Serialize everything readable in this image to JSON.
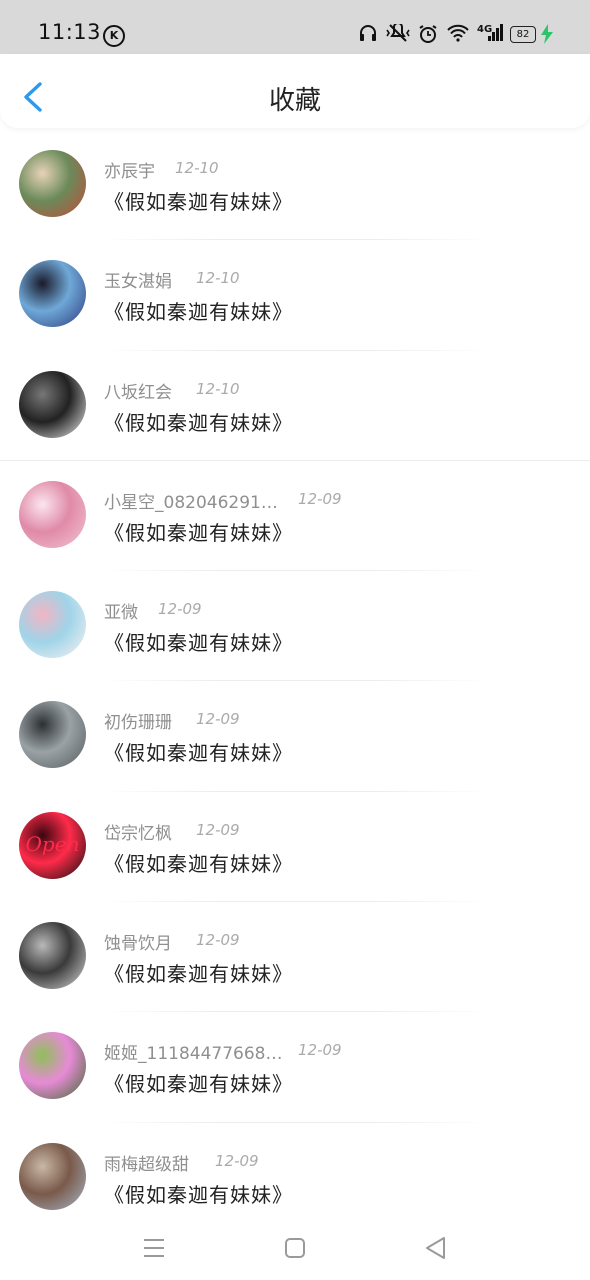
{
  "status_bar": {
    "time": "11:13",
    "k_badge": "K",
    "network": "4G",
    "battery": "82",
    "icons": [
      "headphones-icon",
      "mute-icon",
      "alarm-icon",
      "wifi-icon",
      "signal-icon",
      "battery-icon",
      "charging-icon"
    ]
  },
  "header": {
    "title": "收藏",
    "back_icon": "chevron-left-icon",
    "accent_color": "#2a9af0"
  },
  "items": [
    {
      "username": "亦辰宇",
      "date": "12-10",
      "title": "《假如秦迦有妹妹》",
      "avatar_colors": [
        "#c44a3a",
        "#6b8a5a",
        "#e8d3b8"
      ]
    },
    {
      "username": "玉女湛娟",
      "date": "12-10",
      "title": "《假如秦迦有妹妹》",
      "avatar_colors": [
        "#2b3a7a",
        "#6fa8d8",
        "#1a1a2a"
      ]
    },
    {
      "username": "八坂红会",
      "date": "12-10",
      "title": "《假如秦迦有妹妹》",
      "avatar_colors": [
        "#f2f2f2",
        "#222222",
        "#777777"
      ]
    },
    {
      "username": "小星空_082046291…",
      "date": "12-09",
      "title": "《假如秦迦有妹妹》",
      "avatar_colors": [
        "#f3c6d2",
        "#e08aa8",
        "#fbe6ee"
      ]
    },
    {
      "username": "亚微",
      "date": "12-09",
      "title": "《假如秦迦有妹妹》",
      "avatar_colors": [
        "#fdf3f3",
        "#9fd4e8",
        "#f2b5c4"
      ]
    },
    {
      "username": "初伤珊珊",
      "date": "12-09",
      "title": "《假如秦迦有妹妹》",
      "avatar_colors": [
        "#555a5e",
        "#9aa2a6",
        "#2c3033"
      ]
    },
    {
      "username": "岱宗忆枫",
      "date": "12-09",
      "title": "《假如秦迦有妹妹》",
      "avatar_colors": [
        "#0c0c0c",
        "#ff2b4a",
        "#3a0610"
      ],
      "avatar_text": "Open"
    },
    {
      "username": "蚀骨饮月",
      "date": "12-09",
      "title": "《假如秦迦有妹妹》",
      "avatar_colors": [
        "#dcdcdc",
        "#3a3a3a",
        "#b9b9b9"
      ]
    },
    {
      "username": "姬姬_11184477668…",
      "date": "12-09",
      "title": "《假如秦迦有妹妹》",
      "avatar_colors": [
        "#3c6b2a",
        "#e78ad6",
        "#8fbf5a"
      ]
    },
    {
      "username": "雨梅超级甜",
      "date": "12-09",
      "title": "《假如秦迦有妹妹》",
      "avatar_colors": [
        "#a7b8c9",
        "#7a5a4a",
        "#c9b8a7"
      ]
    }
  ],
  "nav": {
    "menu_icon": "menu-icon",
    "home_icon": "home-square-icon",
    "back_icon": "back-triangle-icon"
  }
}
